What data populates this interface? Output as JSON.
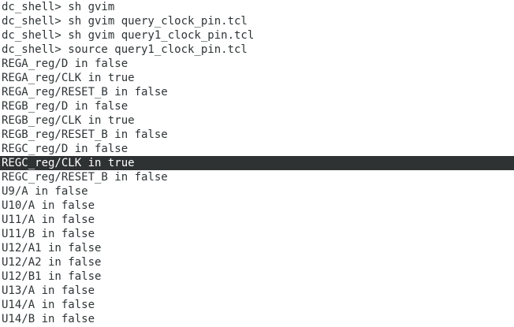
{
  "terminal": {
    "colors": {
      "background": "#ffffff",
      "text": "#2e3436",
      "selection_background": "#2f3233",
      "selection_text": "#ffffff"
    },
    "lines": [
      {
        "text": "dc_shell> sh gvim",
        "selected": false
      },
      {
        "text": "dc_shell> sh gvim query_clock_pin.tcl",
        "selected": false
      },
      {
        "text": "dc_shell> sh gvim query1_clock_pin.tcl",
        "selected": false
      },
      {
        "text": "dc_shell> source query1_clock_pin.tcl",
        "selected": false
      },
      {
        "text": "REGA_reg/D in false",
        "selected": false
      },
      {
        "text": "REGA_reg/CLK in true",
        "selected": false
      },
      {
        "text": "REGA_reg/RESET_B in false",
        "selected": false
      },
      {
        "text": "REGB_reg/D in false",
        "selected": false
      },
      {
        "text": "REGB_reg/CLK in true",
        "selected": false
      },
      {
        "text": "REGB_reg/RESET_B in false",
        "selected": false
      },
      {
        "text": "REGC_reg/D in false",
        "selected": false
      },
      {
        "text": "REGC_reg/CLK in true",
        "selected": true
      },
      {
        "text": "REGC_reg/RESET_B in false",
        "selected": false
      },
      {
        "text": "U9/A in false",
        "selected": false
      },
      {
        "text": "U10/A in false",
        "selected": false
      },
      {
        "text": "U11/A in false",
        "selected": false
      },
      {
        "text": "U11/B in false",
        "selected": false
      },
      {
        "text": "U12/A1 in false",
        "selected": false
      },
      {
        "text": "U12/A2 in false",
        "selected": false
      },
      {
        "text": "U12/B1 in false",
        "selected": false
      },
      {
        "text": "U13/A in false",
        "selected": false
      },
      {
        "text": "U14/A in false",
        "selected": false
      },
      {
        "text": "U14/B in false",
        "selected": false
      }
    ]
  }
}
